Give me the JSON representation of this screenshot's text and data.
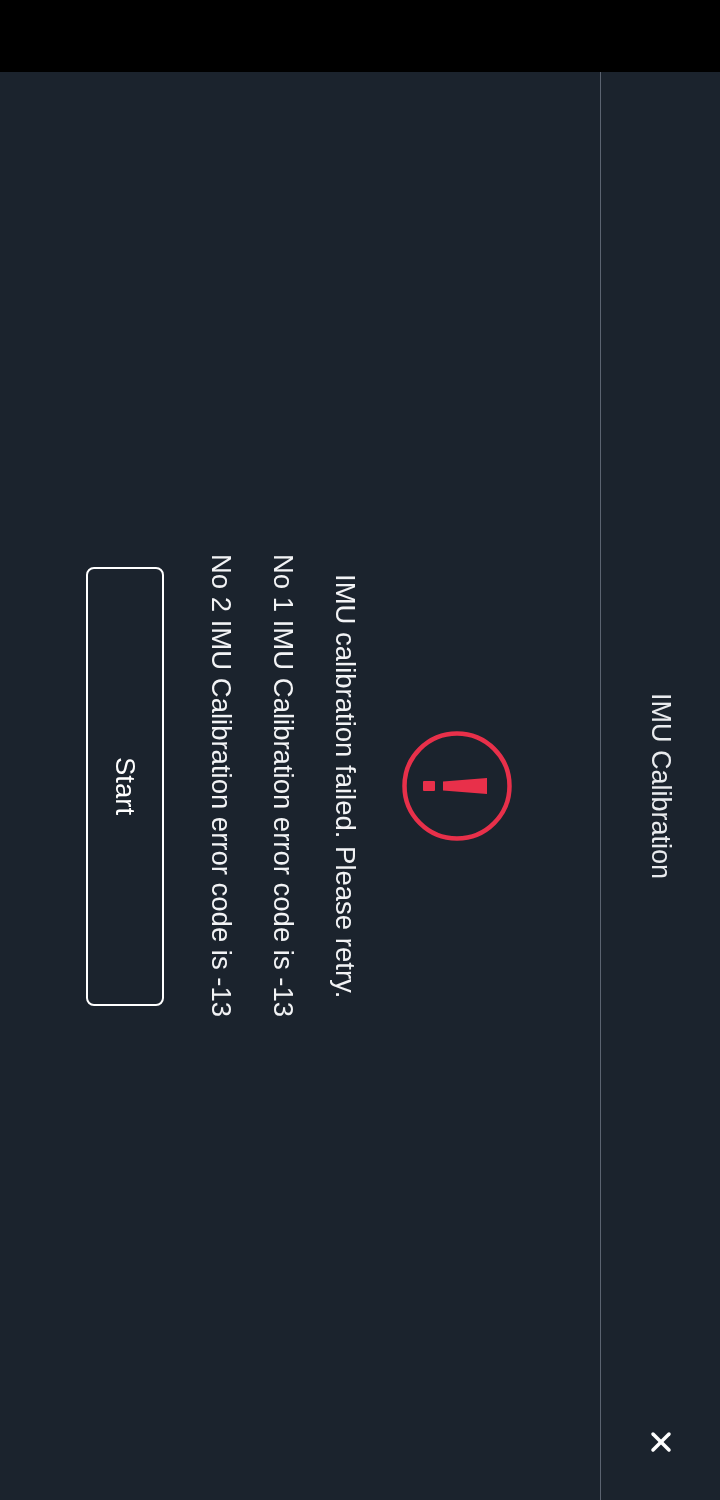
{
  "header": {
    "title": "IMU Calibration"
  },
  "dialog": {
    "message": "IMU calibration failed. Please retry.",
    "errors": [
      "No 1 IMU Calibration error code is -13",
      "No 2 IMU Calibration error code is -13"
    ],
    "button": "Start"
  }
}
